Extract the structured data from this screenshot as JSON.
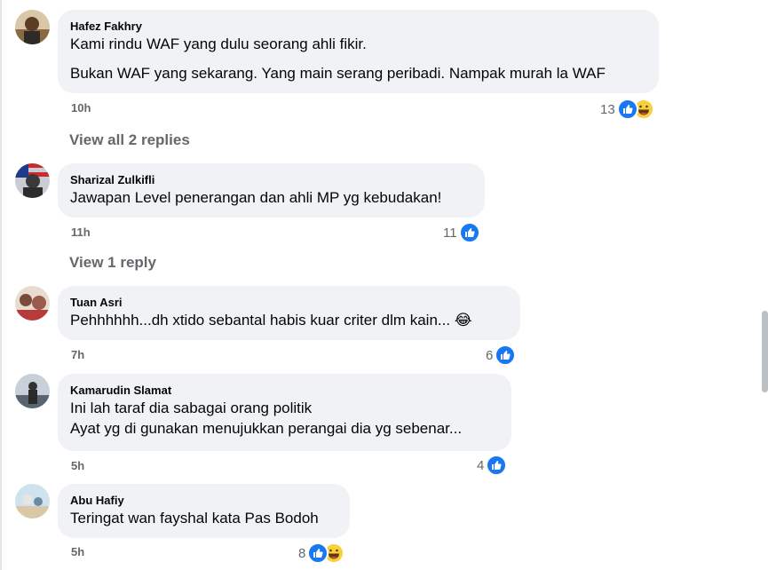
{
  "comments": [
    {
      "author": "Hafez Fakhry",
      "lines": [
        "Kami rindu WAF yang dulu seorang ahli fikir.",
        "Bukan WAF yang sekarang. Yang main serang peribadi. Nampak murah la WAF"
      ],
      "time": "10h",
      "reaction_count": "13",
      "reactions": [
        "like",
        "haha"
      ]
    },
    {
      "author": "Sharizal Zulkifli",
      "lines": [
        "Jawapan Level penerangan dan ahli MP yg kebudakan!"
      ],
      "time": "11h",
      "reaction_count": "11",
      "reactions": [
        "like"
      ]
    },
    {
      "author": "Tuan Asri",
      "lines": [
        "Pehhhhhh...dh xtido sebantal habis kuar criter dlm kain... 😂"
      ],
      "time": "7h",
      "reaction_count": "6",
      "reactions": [
        "like"
      ]
    },
    {
      "author": "Kamarudin Slamat",
      "lines": [
        "Ini lah taraf dia sabagai orang politik",
        "Ayat yg di gunakan menujukkan perangai dia yg sebenar..."
      ],
      "time": "5h",
      "reaction_count": "4",
      "reactions": [
        "like"
      ]
    },
    {
      "author": "Abu Hafiy",
      "lines": [
        "Teringat wan fayshal kata Pas Bodoh"
      ],
      "time": "5h",
      "reaction_count": "8",
      "reactions": [
        "like",
        "haha"
      ]
    }
  ],
  "view_replies": [
    "View all 2 replies",
    "View 1 reply"
  ],
  "colors": {
    "like": "#1877f2",
    "bubble": "#f0f2f5",
    "secondary_text": "#65676b"
  }
}
